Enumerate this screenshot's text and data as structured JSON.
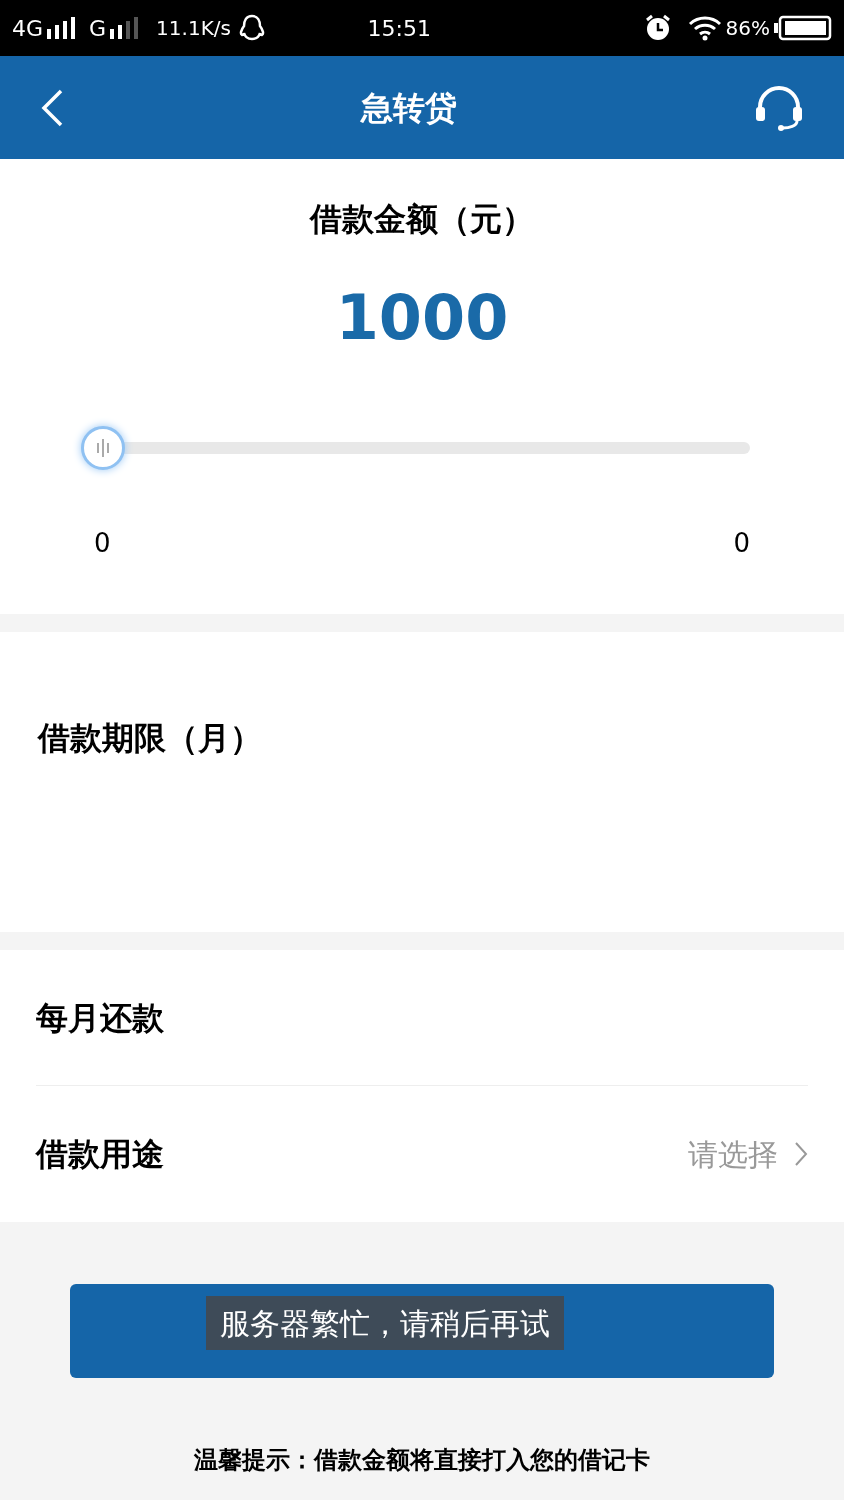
{
  "status_bar": {
    "network": "4G",
    "network_2": "G",
    "speed": "11.1K/s",
    "time": "15:51",
    "battery": "86%"
  },
  "nav": {
    "title": "急转贷"
  },
  "amount": {
    "label": "借款金额（元）",
    "value": "1000",
    "level": 0,
    "min": "0",
    "max": "0"
  },
  "term": {
    "label": "借款期限（月）"
  },
  "rows": [
    {
      "label": "每月还款"
    },
    {
      "label": "借款用途",
      "placeholder": "请选择"
    }
  ],
  "toast": "服务器繁忙，请稍后再试",
  "tip": "温馨提示：借款金额将直接打入您的借记卡"
}
